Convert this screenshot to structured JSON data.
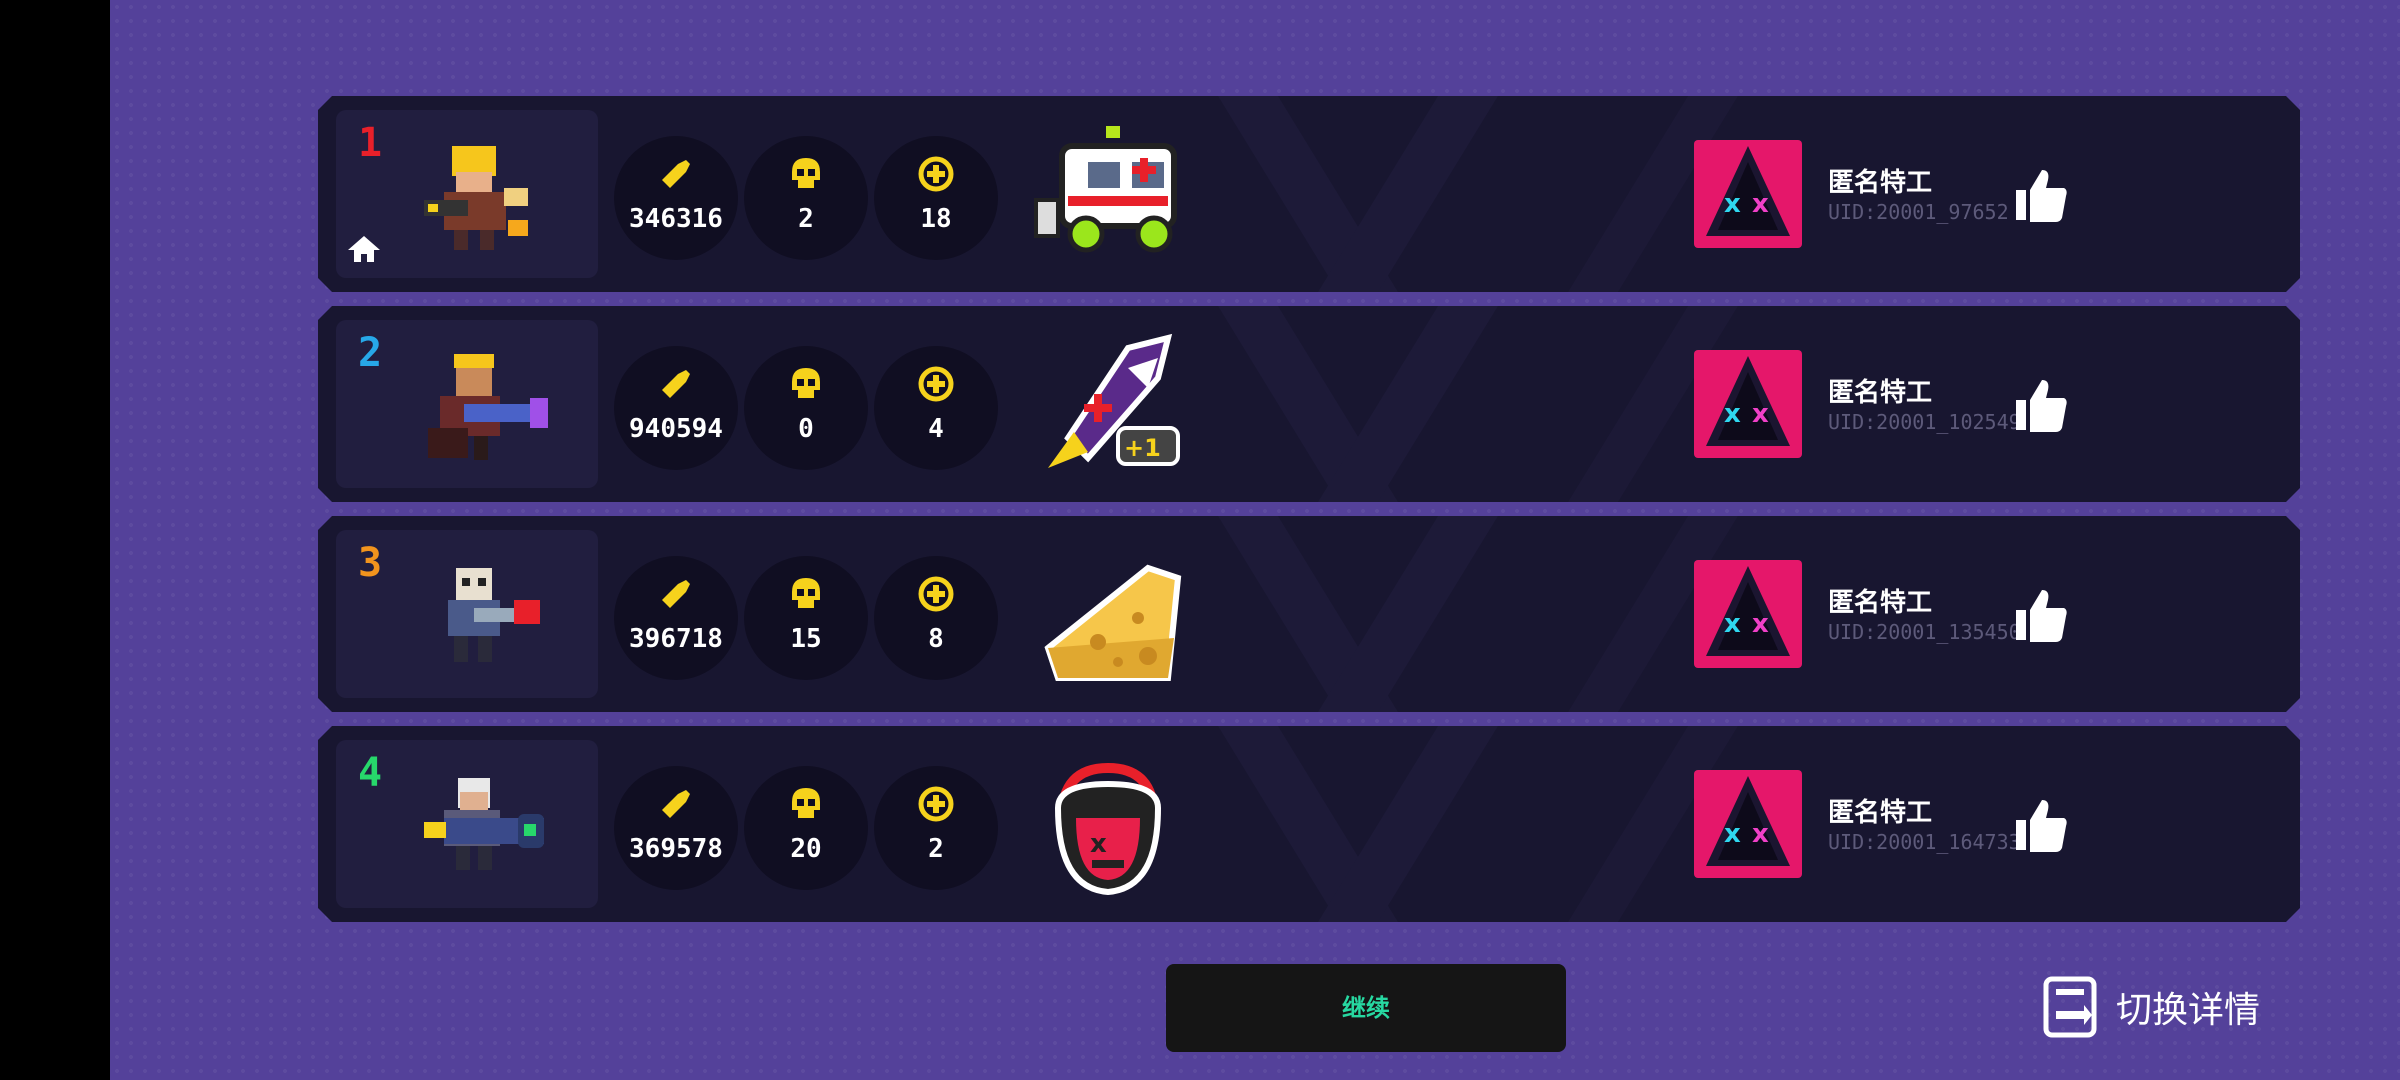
{
  "rows": [
    {
      "rank": "1",
      "rank_color": "#e8202a",
      "ammo": "346316",
      "kills": "2",
      "heals": "18",
      "item_icon": "ambulance-icon",
      "player_name": "匿名特工",
      "uid": "UID:20001_97652",
      "is_self": true
    },
    {
      "rank": "2",
      "rank_color": "#27a8e8",
      "ammo": "940594",
      "kills": "0",
      "heals": "4",
      "item_icon": "shark-rocket-icon",
      "player_name": "匿名特工",
      "uid": "UID:20001_102549",
      "is_self": false
    },
    {
      "rank": "3",
      "rank_color": "#f2941d",
      "ammo": "396718",
      "kills": "15",
      "heals": "8",
      "item_icon": "cheese-icon",
      "player_name": "匿名特工",
      "uid": "UID:20001_135450",
      "is_self": false
    },
    {
      "rank": "4",
      "rank_color": "#27d86b",
      "ammo": "369578",
      "kills": "20",
      "heals": "2",
      "item_icon": "devil-headphones-icon",
      "player_name": "匿名特工",
      "uid": "UID:20001_164733",
      "is_self": false
    }
  ],
  "continue_label": "继续",
  "switch_label": "切换详情",
  "colors": {
    "background": "#54419a",
    "row": "#181630",
    "accent_yellow": "#f6d21c",
    "continue_text": "#27d8a1",
    "avatar": "#e5176a"
  }
}
